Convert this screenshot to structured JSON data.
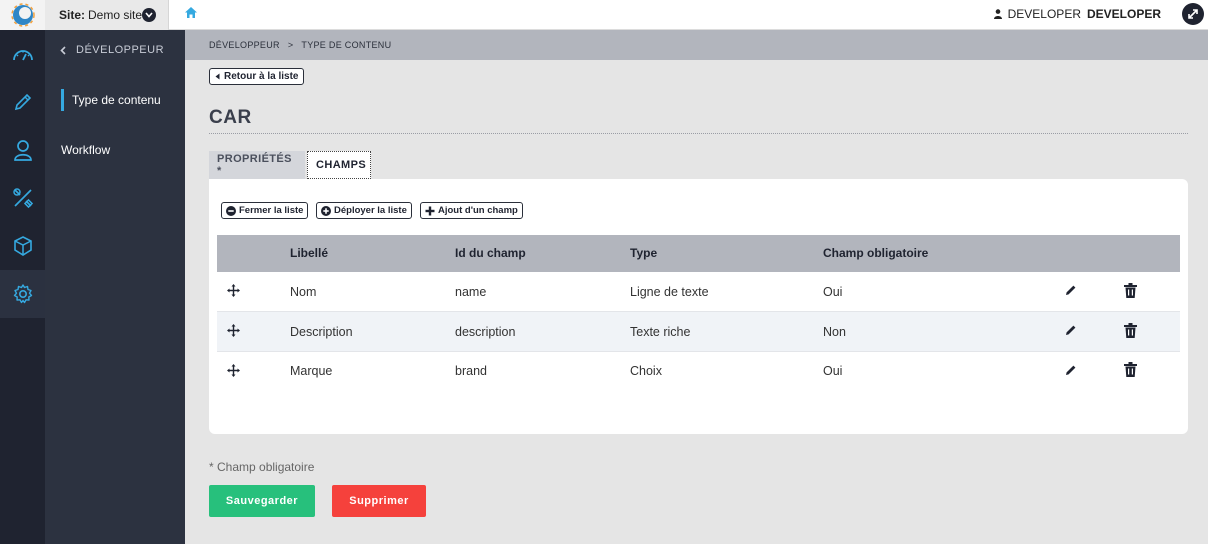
{
  "topbar": {
    "site_prefix": "Site:",
    "site_name": "Demo site",
    "user_first": "DEVELOPER",
    "user_last": "DEVELOPER"
  },
  "subnav": {
    "back_label": "DÉVELOPPEUR",
    "items": [
      {
        "label": "Type de contenu"
      },
      {
        "label": "Workflow"
      }
    ]
  },
  "breadcrumb": {
    "parent": "DÉVELOPPEUR",
    "sep": ">",
    "current": "TYPE DE CONTENU"
  },
  "back_button": "Retour à la liste",
  "page_title": "CAR",
  "tabs": [
    {
      "label": "PROPRIÉTÉS *"
    },
    {
      "label": "CHAMPS"
    }
  ],
  "toolbar": {
    "collapse": "Fermer la liste",
    "expand": "Déployer la liste",
    "add": "Ajout d'un champ"
  },
  "table": {
    "headers": [
      "Libellé",
      "Id du champ",
      "Type",
      "Champ obligatoire"
    ],
    "rows": [
      {
        "label": "Nom",
        "id": "name",
        "type": "Ligne de texte",
        "required": "Oui"
      },
      {
        "label": "Description",
        "id": "description",
        "type": "Texte riche",
        "required": "Non"
      },
      {
        "label": "Marque",
        "id": "brand",
        "type": "Choix",
        "required": "Oui"
      }
    ]
  },
  "footnote": "* Champ obligatoire",
  "actions": {
    "save": "Sauvegarder",
    "delete": "Supprimer"
  },
  "colors": {
    "accent": "#35a9e0",
    "save": "#27c07c",
    "delete": "#f5413c",
    "sidebar": "#1f2330"
  }
}
